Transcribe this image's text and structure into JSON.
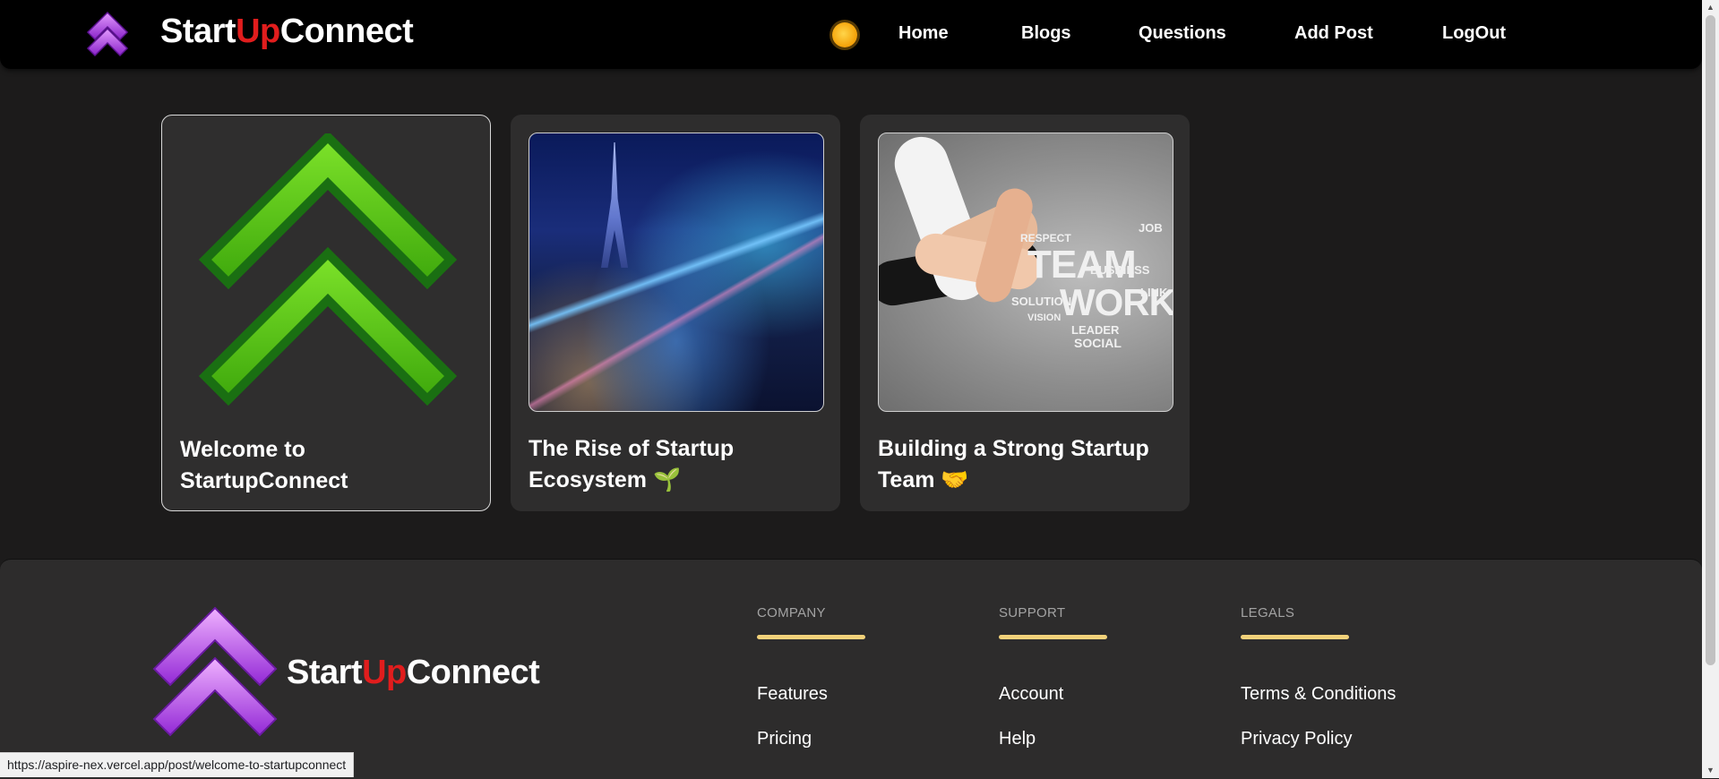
{
  "navbar": {
    "brand": {
      "start": "Start",
      "up": "Up",
      "connect": "Connect"
    },
    "theme_toggle_icon": "sun-icon",
    "links": [
      {
        "label": "Home"
      },
      {
        "label": "Blogs"
      },
      {
        "label": "Questions"
      },
      {
        "label": "Add Post"
      },
      {
        "label": "LogOut"
      }
    ]
  },
  "posts": [
    {
      "title": "Welcome to StartupConnect",
      "image": "startupconnect-green-logo"
    },
    {
      "title": "The Rise of Startup Ecosystem 🌱",
      "image": "night-city-skyline"
    },
    {
      "title": "Building a Strong Startup Team 🤝",
      "image": "team-work-word-cloud"
    }
  ],
  "team_image_words": [
    "TEAM",
    "WORK",
    "RESPECT",
    "BUSINESS",
    "SOLUTION",
    "LEADER",
    "SOCIAL",
    "LINK",
    "JOB",
    "VISION"
  ],
  "footer": {
    "brand": {
      "start": "Start",
      "up": "Up",
      "connect": "Connect"
    },
    "columns": [
      {
        "heading": "COMPANY",
        "links": [
          "Features",
          "Pricing"
        ]
      },
      {
        "heading": "SUPPORT",
        "links": [
          "Account",
          "Help"
        ]
      },
      {
        "heading": "LEGALS",
        "links": [
          "Terms & Conditions",
          "Privacy Policy"
        ]
      }
    ]
  },
  "status_bar": {
    "url": "https://aspire-nex.vercel.app/post/welcome-to-startupconnect"
  },
  "colors": {
    "brand_up_red": "#e11d1d",
    "logo_purple": "#b04ae0",
    "logo_green": "#4fcf16",
    "footer_accent": "#f2d27a"
  }
}
